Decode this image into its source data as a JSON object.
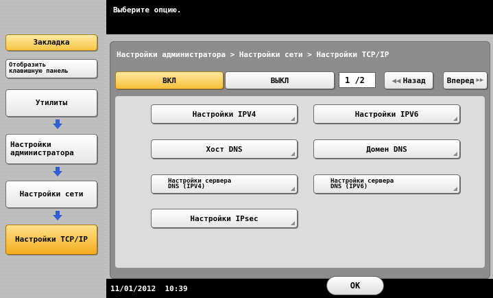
{
  "sidebar": {
    "bookmark": "Закладка",
    "keypad_line1": "Отобразить",
    "keypad_line2": "клавишную панель",
    "utilities": "Утилиты",
    "admin_line1": "Настройки",
    "admin_line2": "администратора",
    "network": "Настройки сети",
    "tcpip": "Настройки TCP/IP"
  },
  "top": {
    "message": "Выберите опцию."
  },
  "panel": {
    "breadcrumb": "Настройки администратора > Настройки сети > Настройки TCP/IP",
    "on_label": "ВКЛ",
    "off_label": "ВЫКЛ",
    "page_indicator": "1 /2",
    "back_label": "Назад",
    "forward_label": "Вперед",
    "options": {
      "ipv4": "Настройки IPV4",
      "ipv6": "Настройки IPV6",
      "dns_host": "Хост DNS",
      "dns_domain": "Домен DNS",
      "dns_server_ipv4_line1": "Настройки сервера",
      "dns_server_ipv4_line2": "DNS (IPV4)",
      "dns_server_ipv6_line1": "Настройки сервера",
      "dns_server_ipv6_line2": "DNS (IPV6)",
      "ipsec": "Настройки IPsec"
    }
  },
  "status": {
    "datetime": "11/01/2012  10:39",
    "ok_label": "OK"
  },
  "colors": {
    "highlight": "#f6c13a",
    "arrow": "#2f5fd0"
  }
}
